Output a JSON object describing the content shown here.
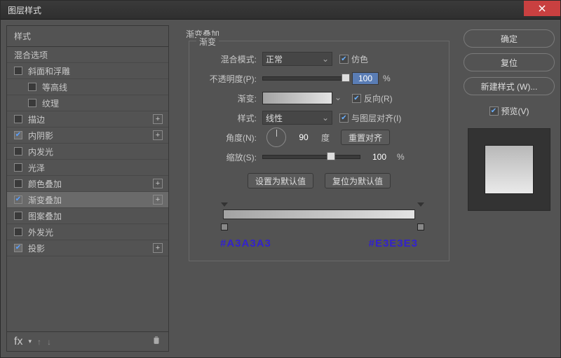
{
  "title": "图层样式",
  "sidebar": {
    "header": "样式",
    "blendOptions": "混合选项",
    "items": [
      {
        "label": "斜面和浮雕",
        "checked": false,
        "plus": false,
        "sub": false
      },
      {
        "label": "等高线",
        "checked": false,
        "plus": false,
        "sub": true
      },
      {
        "label": "纹理",
        "checked": false,
        "plus": false,
        "sub": true
      },
      {
        "label": "描边",
        "checked": false,
        "plus": true,
        "sub": false
      },
      {
        "label": "内阴影",
        "checked": true,
        "plus": true,
        "sub": false
      },
      {
        "label": "内发光",
        "checked": false,
        "plus": false,
        "sub": false
      },
      {
        "label": "光泽",
        "checked": false,
        "plus": false,
        "sub": false
      },
      {
        "label": "颜色叠加",
        "checked": false,
        "plus": true,
        "sub": false
      },
      {
        "label": "渐变叠加",
        "checked": true,
        "plus": true,
        "sub": false,
        "selected": true
      },
      {
        "label": "图案叠加",
        "checked": false,
        "plus": false,
        "sub": false
      },
      {
        "label": "外发光",
        "checked": false,
        "plus": false,
        "sub": false
      },
      {
        "label": "投影",
        "checked": true,
        "plus": true,
        "sub": false
      }
    ],
    "footFx": "fx"
  },
  "panel": {
    "title": "渐变叠加",
    "groupLegend": "渐变",
    "blendModeLabel": "混合模式:",
    "blendModeValue": "正常",
    "ditherLabel": "仿色",
    "opacityLabel": "不透明度(P):",
    "opacityValue": "100",
    "opacityUnit": "%",
    "gradientLabel": "渐变:",
    "reverseLabel": "反向(R)",
    "styleLabel": "样式:",
    "styleValue": "线性",
    "alignLabel": "与图层对齐(I)",
    "angleLabel": "角度(N):",
    "angleValue": "90",
    "angleUnit": "度",
    "resetAlign": "重置对齐",
    "scaleLabel": "缩放(S):",
    "scaleValue": "100",
    "scaleUnit": "%",
    "setDefault": "设置为默认值",
    "resetDefault": "复位为默认值",
    "colorLeft": "#A3A3A3",
    "colorRight": "#E3E3E3"
  },
  "right": {
    "ok": "确定",
    "cancel": "复位",
    "newStyle": "新建样式 (W)...",
    "previewLabel": "预览(V)"
  }
}
